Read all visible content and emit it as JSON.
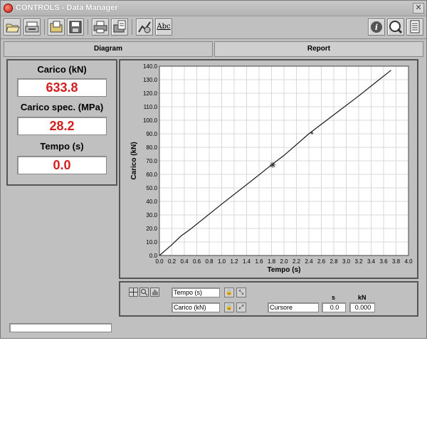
{
  "window": {
    "title": "CONTROLS - Data Manager"
  },
  "toolbar": {
    "left_icons": [
      "open-folder-icon",
      "print-preview-icon",
      "open-file-icon",
      "save-icon",
      "print-icon",
      "export-icon",
      "graph-settings-icon",
      "font-abc-icon"
    ],
    "abc_label": "Abc",
    "right_icons": [
      "info-icon",
      "search-icon",
      "report-icon"
    ]
  },
  "tabs": [
    {
      "label": "Diagram",
      "active": true
    },
    {
      "label": "Report",
      "active": false
    }
  ],
  "readouts": {
    "carico_label": "Carico (kN)",
    "carico_value": "633.8",
    "carico_spec_label": "Carico spec. (MPa)",
    "carico_spec_value": "28.2",
    "tempo_label": "Tempo (s)",
    "tempo_value": "0.0"
  },
  "chart_data": {
    "type": "line",
    "xlabel": "Tempo (s)",
    "ylabel": "Carico (kN)",
    "xlim": [
      0.0,
      4.0
    ],
    "ylim": [
      0.0,
      140.0
    ],
    "x_ticks": [
      "0.0",
      "0.2",
      "0.4",
      "0.6",
      "0.8",
      "1.0",
      "1.2",
      "1.4",
      "1.6",
      "1.8",
      "2.0",
      "2.2",
      "2.4",
      "2.6",
      "2.8",
      "3.0",
      "3.2",
      "3.4",
      "3.6",
      "3.8",
      "4.0"
    ],
    "y_ticks": [
      "0.0",
      "10.0",
      "20.0",
      "30.0",
      "40.0",
      "50.0",
      "60.0",
      "70.0",
      "80.0",
      "90.0",
      "100.0",
      "110.0",
      "120.0",
      "130.0",
      "140.0"
    ],
    "grid": true,
    "series": [
      {
        "x": [
          0.0,
          0.1,
          0.2,
          0.35,
          0.5,
          1.0,
          1.5,
          1.8,
          2.0,
          2.4,
          2.8,
          3.2,
          3.5,
          3.72
        ],
        "y": [
          0.0,
          4.0,
          8.0,
          14.5,
          19.5,
          38.0,
          56.0,
          67.0,
          74.0,
          90.0,
          104.0,
          118.0,
          129.0,
          137.0
        ]
      }
    ],
    "markers": [
      {
        "x": 1.82,
        "y": 67.0,
        "shape": "star"
      },
      {
        "x": 2.45,
        "y": 90.5,
        "shape": "tick"
      }
    ]
  },
  "cursor_panel": {
    "x_field": "Tempo (s)",
    "y_field": "Carico (kN)",
    "cursor_label": "Cursore",
    "unit_s": "s",
    "unit_kn": "kN",
    "s_value": "0.0",
    "kn_value": "0.000"
  },
  "statusbar": {
    "text": ""
  }
}
